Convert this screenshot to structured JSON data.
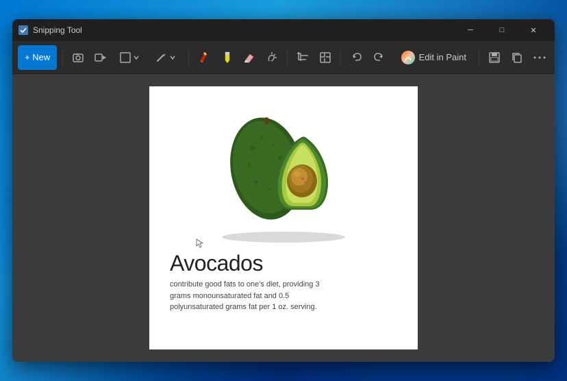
{
  "window": {
    "title": "Snipping Tool",
    "minimize_label": "─",
    "maximize_label": "□",
    "close_label": "✕"
  },
  "toolbar": {
    "new_label": "+ New",
    "screenshot_tooltip": "Screenshot",
    "record_tooltip": "Record",
    "shape_tooltip": "Shape",
    "tools_tooltip": "Tools",
    "pen_tooltip": "Pen",
    "marker_tooltip": "Marker",
    "eraser_tooltip": "Eraser",
    "touch_tooltip": "Touch writing",
    "crop_tooltip": "Crop",
    "trim_tooltip": "Trim",
    "undo_tooltip": "Undo",
    "redo_tooltip": "Redo",
    "edit_in_paint_label": "Edit in Paint",
    "save_tooltip": "Save",
    "copy_tooltip": "Copy",
    "more_tooltip": "More options"
  },
  "content": {
    "avocado_title": "Avocados",
    "avocado_description": "contribute good fats to one's diet, providing 3 grams monounsaturated fat and 0.5 polyunsaturated grams fat per 1 oz. serving."
  }
}
